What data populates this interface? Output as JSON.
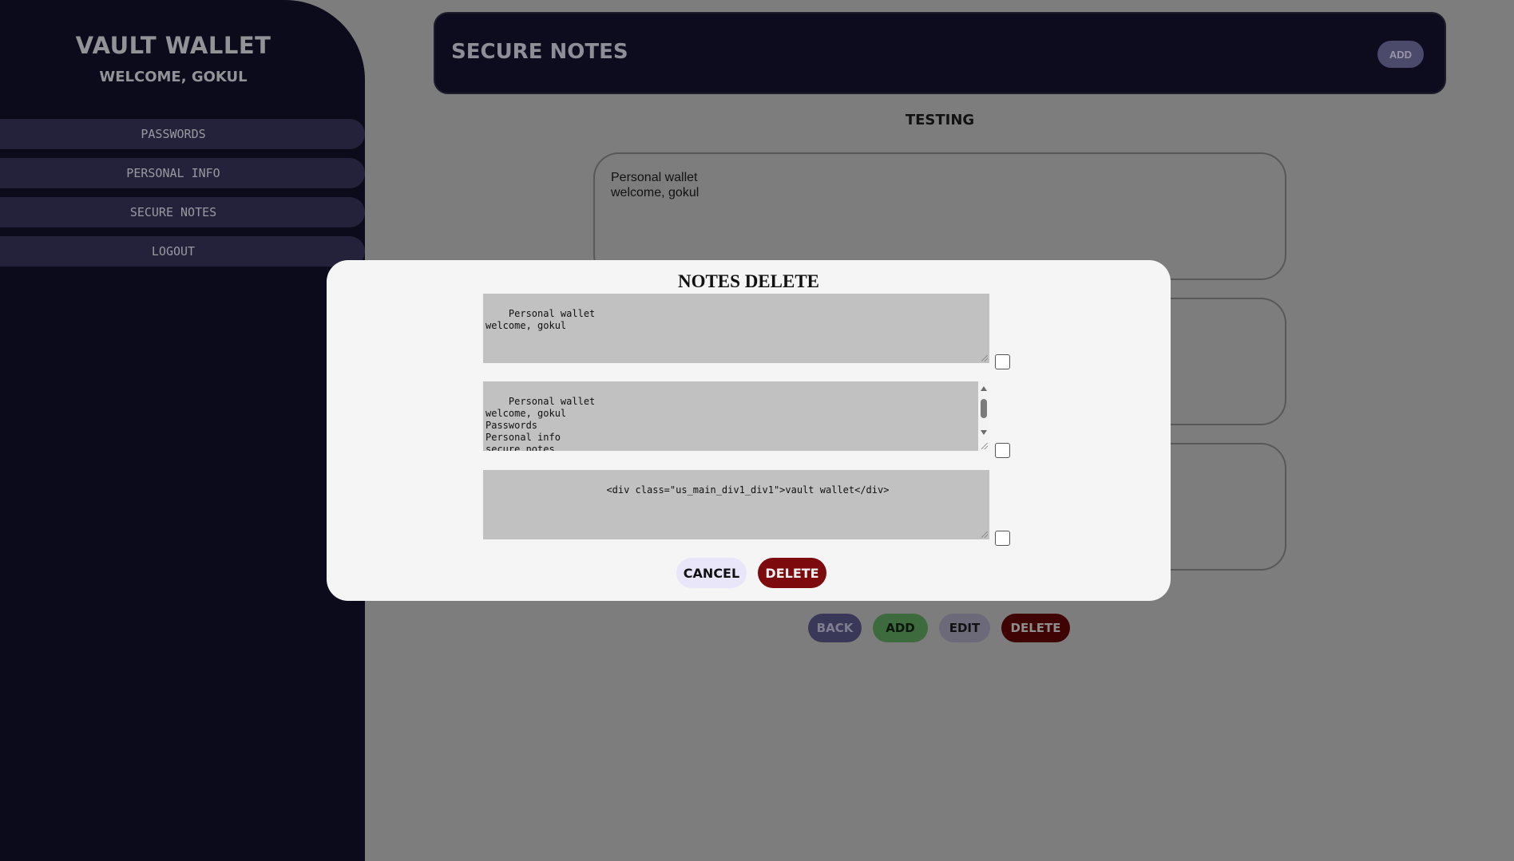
{
  "sidebar": {
    "title": "VAULT WALLET",
    "welcome": "WELCOME, GOKUL",
    "items": [
      {
        "label": "PASSWORDS"
      },
      {
        "label": "PERSONAL INFO"
      },
      {
        "label": "SECURE NOTES"
      },
      {
        "label": "LOGOUT"
      }
    ]
  },
  "header": {
    "title": "SECURE NOTES",
    "add_label": "ADD"
  },
  "main": {
    "note_title": "TESTING",
    "notes": [
      "Personal wallet\nwelcome, gokul",
      "",
      ""
    ],
    "actions": {
      "back": "BACK",
      "add": "ADD",
      "edit": "EDIT",
      "delete": "DELETE"
    }
  },
  "modal": {
    "title": "NOTES DELETE",
    "notes": [
      "Personal wallet\nwelcome, gokul",
      "Personal wallet\nwelcome, gokul\nPasswords\nPersonal info\nsecure notes\nLOGOUT",
      "<div class=\"us_main_div1_div1\">vault wallet</div>"
    ],
    "cancel_label": "CANCEL",
    "delete_label": "DELETE"
  },
  "colors": {
    "sidebar_bg": "#0d0c1f",
    "overlay": "#7d7d7d",
    "delete_red": "#7d0a0c",
    "cancel_bg": "#e8e6f8"
  }
}
